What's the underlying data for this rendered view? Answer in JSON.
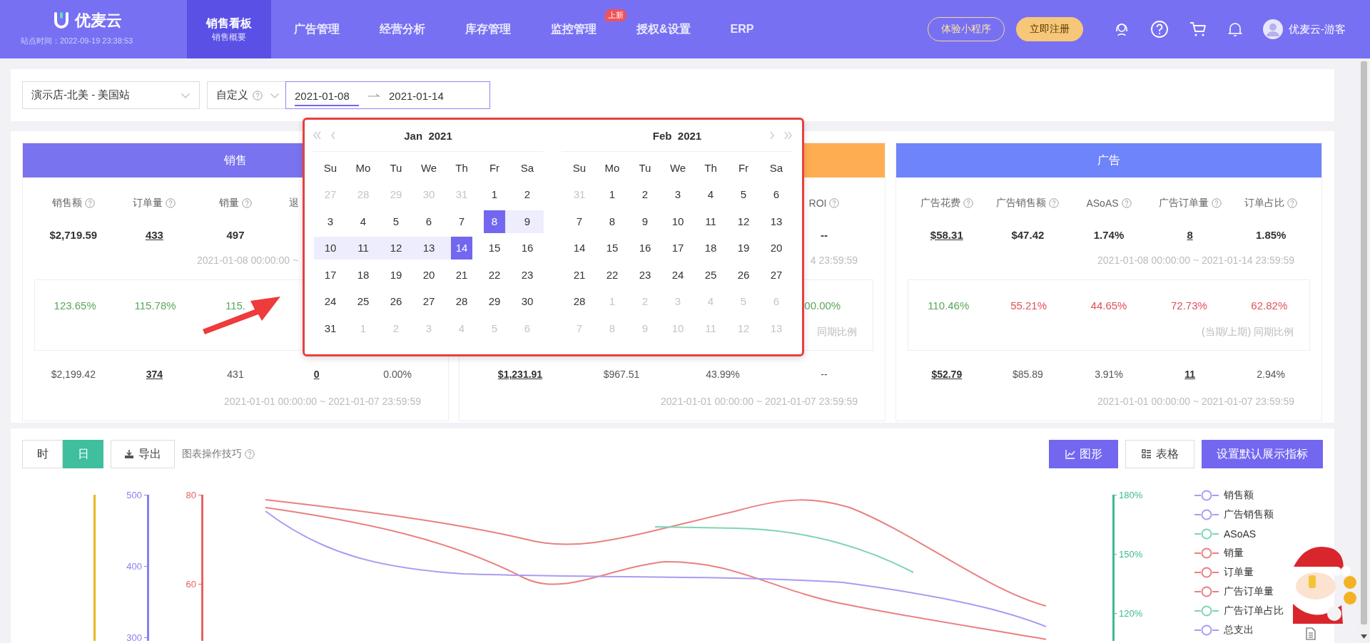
{
  "header": {
    "logo": "优麦云",
    "site_time": "站点时间：2022-09-19 23:38:53",
    "nav": [
      {
        "label": "销售看板",
        "sub": "销售概要",
        "selected": true
      },
      {
        "label": "广告管理",
        "selected": false
      },
      {
        "label": "经营分析",
        "selected": false
      },
      {
        "label": "库存管理",
        "selected": false
      },
      {
        "label": "监控管理",
        "badge": "上新",
        "selected": false
      },
      {
        "label": "授权&设置",
        "selected": false
      },
      {
        "label": "ERP",
        "selected": false
      }
    ],
    "actions": [
      {
        "label": "体验小程序",
        "kind": "outline"
      },
      {
        "label": "立即注册",
        "kind": "gold"
      }
    ],
    "user": "优麦云-游客"
  },
  "filters": {
    "store": "演示店-北美 - 美国站",
    "period": "自定义",
    "date_start": "2021-01-08",
    "date_end": "2021-01-14"
  },
  "date_picker": {
    "months": [
      {
        "title": "Jan  2021",
        "weekdays": [
          "Su",
          "Mo",
          "Tu",
          "We",
          "Th",
          "Fr",
          "Sa"
        ],
        "days": [
          {
            "day": "27",
            "outside": true,
            "selected": false,
            "in_range": false
          },
          {
            "day": "28",
            "outside": true,
            "selected": false,
            "in_range": false
          },
          {
            "day": "29",
            "outside": true,
            "selected": false,
            "in_range": false
          },
          {
            "day": "30",
            "outside": true,
            "selected": false,
            "in_range": false
          },
          {
            "day": "31",
            "outside": true,
            "selected": false,
            "in_range": false
          },
          {
            "day": "1",
            "outside": false,
            "selected": false,
            "in_range": false
          },
          {
            "day": "2",
            "outside": false,
            "selected": false,
            "in_range": false
          },
          {
            "day": "3",
            "outside": false,
            "selected": false,
            "in_range": false
          },
          {
            "day": "4",
            "outside": false,
            "selected": false,
            "in_range": false
          },
          {
            "day": "5",
            "outside": false,
            "selected": false,
            "in_range": false
          },
          {
            "day": "6",
            "outside": false,
            "selected": false,
            "in_range": false
          },
          {
            "day": "7",
            "outside": false,
            "selected": false,
            "in_range": false
          },
          {
            "day": "8",
            "outside": false,
            "selected": true,
            "in_range": false
          },
          {
            "day": "9",
            "outside": false,
            "selected": false,
            "in_range": true
          },
          {
            "day": "10",
            "outside": false,
            "selected": false,
            "in_range": true
          },
          {
            "day": "11",
            "outside": false,
            "selected": false,
            "in_range": true
          },
          {
            "day": "12",
            "outside": false,
            "selected": false,
            "in_range": true
          },
          {
            "day": "13",
            "outside": false,
            "selected": false,
            "in_range": true
          },
          {
            "day": "14",
            "outside": false,
            "selected": true,
            "in_range": false
          },
          {
            "day": "15",
            "outside": false,
            "selected": false,
            "in_range": false
          },
          {
            "day": "16",
            "outside": false,
            "selected": false,
            "in_range": false
          },
          {
            "day": "17",
            "outside": false,
            "selected": false,
            "in_range": false
          },
          {
            "day": "18",
            "outside": false,
            "selected": false,
            "in_range": false
          },
          {
            "day": "19",
            "outside": false,
            "selected": false,
            "in_range": false
          },
          {
            "day": "20",
            "outside": false,
            "selected": false,
            "in_range": false
          },
          {
            "day": "21",
            "outside": false,
            "selected": false,
            "in_range": false
          },
          {
            "day": "22",
            "outside": false,
            "selected": false,
            "in_range": false
          },
          {
            "day": "23",
            "outside": false,
            "selected": false,
            "in_range": false
          },
          {
            "day": "24",
            "outside": false,
            "selected": false,
            "in_range": false
          },
          {
            "day": "25",
            "outside": false,
            "selected": false,
            "in_range": false
          },
          {
            "day": "26",
            "outside": false,
            "selected": false,
            "in_range": false
          },
          {
            "day": "27",
            "outside": false,
            "selected": false,
            "in_range": false
          },
          {
            "day": "28",
            "outside": false,
            "selected": false,
            "in_range": false
          },
          {
            "day": "29",
            "outside": false,
            "selected": false,
            "in_range": false
          },
          {
            "day": "30",
            "outside": false,
            "selected": false,
            "in_range": false
          },
          {
            "day": "31",
            "outside": false,
            "selected": false,
            "in_range": false
          },
          {
            "day": "1",
            "outside": true,
            "selected": false,
            "in_range": false
          },
          {
            "day": "2",
            "outside": true,
            "selected": false,
            "in_range": false
          },
          {
            "day": "3",
            "outside": true,
            "selected": false,
            "in_range": false
          },
          {
            "day": "4",
            "outside": true,
            "selected": false,
            "in_range": false
          },
          {
            "day": "5",
            "outside": true,
            "selected": false,
            "in_range": false
          },
          {
            "day": "6",
            "outside": true,
            "selected": false,
            "in_range": false
          }
        ]
      },
      {
        "title": "Feb  2021",
        "weekdays": [
          "Su",
          "Mo",
          "Tu",
          "We",
          "Th",
          "Fr",
          "Sa"
        ],
        "days": [
          {
            "day": "31",
            "outside": true,
            "selected": false,
            "in_range": false
          },
          {
            "day": "1",
            "outside": false,
            "selected": false,
            "in_range": false
          },
          {
            "day": "2",
            "outside": false,
            "selected": false,
            "in_range": false
          },
          {
            "day": "3",
            "outside": false,
            "selected": false,
            "in_range": false
          },
          {
            "day": "4",
            "outside": false,
            "selected": false,
            "in_range": false
          },
          {
            "day": "5",
            "outside": false,
            "selected": false,
            "in_range": false
          },
          {
            "day": "6",
            "outside": false,
            "selected": false,
            "in_range": false
          },
          {
            "day": "7",
            "outside": false,
            "selected": false,
            "in_range": false
          },
          {
            "day": "8",
            "outside": false,
            "selected": false,
            "in_range": false
          },
          {
            "day": "9",
            "outside": false,
            "selected": false,
            "in_range": false
          },
          {
            "day": "10",
            "outside": false,
            "selected": false,
            "in_range": false
          },
          {
            "day": "11",
            "outside": false,
            "selected": false,
            "in_range": false
          },
          {
            "day": "12",
            "outside": false,
            "selected": false,
            "in_range": false
          },
          {
            "day": "13",
            "outside": false,
            "selected": false,
            "in_range": false
          },
          {
            "day": "14",
            "outside": false,
            "selected": false,
            "in_range": false
          },
          {
            "day": "15",
            "outside": false,
            "selected": false,
            "in_range": false
          },
          {
            "day": "16",
            "outside": false,
            "selected": false,
            "in_range": false
          },
          {
            "day": "17",
            "outside": false,
            "selected": false,
            "in_range": false
          },
          {
            "day": "18",
            "outside": false,
            "selected": false,
            "in_range": false
          },
          {
            "day": "19",
            "outside": false,
            "selected": false,
            "in_range": false
          },
          {
            "day": "20",
            "outside": false,
            "selected": false,
            "in_range": false
          },
          {
            "day": "21",
            "outside": false,
            "selected": false,
            "in_range": false
          },
          {
            "day": "22",
            "outside": false,
            "selected": false,
            "in_range": false
          },
          {
            "day": "23",
            "outside": false,
            "selected": false,
            "in_range": false
          },
          {
            "day": "24",
            "outside": false,
            "selected": false,
            "in_range": false
          },
          {
            "day": "25",
            "outside": false,
            "selected": false,
            "in_range": false
          },
          {
            "day": "26",
            "outside": false,
            "selected": false,
            "in_range": false
          },
          {
            "day": "27",
            "outside": false,
            "selected": false,
            "in_range": false
          },
          {
            "day": "28",
            "outside": false,
            "selected": false,
            "in_range": false
          },
          {
            "day": "1",
            "outside": true,
            "selected": false,
            "in_range": false
          },
          {
            "day": "2",
            "outside": true,
            "selected": false,
            "in_range": false
          },
          {
            "day": "3",
            "outside": true,
            "selected": false,
            "in_range": false
          },
          {
            "day": "4",
            "outside": true,
            "selected": false,
            "in_range": false
          },
          {
            "day": "5",
            "outside": true,
            "selected": false,
            "in_range": false
          },
          {
            "day": "6",
            "outside": true,
            "selected": false,
            "in_range": false
          },
          {
            "day": "7",
            "outside": true,
            "selected": false,
            "in_range": false
          },
          {
            "day": "8",
            "outside": true,
            "selected": false,
            "in_range": false
          },
          {
            "day": "9",
            "outside": true,
            "selected": false,
            "in_range": false
          },
          {
            "day": "10",
            "outside": true,
            "selected": false,
            "in_range": false
          },
          {
            "day": "11",
            "outside": true,
            "selected": false,
            "in_range": false
          },
          {
            "day": "12",
            "outside": true,
            "selected": false,
            "in_range": false
          },
          {
            "day": "13",
            "outside": true,
            "selected": false,
            "in_range": false
          }
        ]
      }
    ]
  },
  "cards": [
    {
      "title": "销售",
      "color": "#7a73f0",
      "current_range": "2021-01-08 00:00:00 ~",
      "current_range_cut": true,
      "previous_range": "2021-01-01 00:00:00 ~ 2021-01-07 23:59:59",
      "metrics": [
        {
          "label": "销售额",
          "help": true,
          "current": "$2,719.59",
          "current_link": false,
          "ratio": {
            "text": "123.65%",
            "color": "#5aa75a"
          },
          "previous": "$2,199.42",
          "previous_link": false
        },
        {
          "label": "订单量",
          "help": true,
          "current": "433",
          "current_link": true,
          "ratio": {
            "text": "115.78%",
            "color": "#5aa75a"
          },
          "previous": "374",
          "previous_link": true
        },
        {
          "label": "销量",
          "help": true,
          "current": "497",
          "current_link": false,
          "ratio": {
            "text": "115.",
            "color": "#5aa75a"
          },
          "previous": "431",
          "previous_link": false
        },
        {
          "label": "退",
          "label_cut": true,
          "previous": "0",
          "previous_link": true
        },
        {
          "previous": "0.00%",
          "previous_link": false
        }
      ]
    },
    {
      "color": "#ffad52",
      "current_range": "4 23:59:59",
      "current_range_cut": false,
      "ratio_note": "同期比例",
      "previous_range": "2021-01-01 00:00:00 ~ 2021-01-07 23:59:59",
      "metrics": [
        {
          "previous": "$1,231.91",
          "previous_link": true
        },
        {
          "previous": "$967.51",
          "previous_link": false
        },
        {
          "previous": "43.99%",
          "previous_link": false
        },
        {
          "label": "ROI",
          "help": true,
          "current": "--",
          "current_link": false,
          "ratio": {
            "text": "00.00%",
            "color": "#5aa75a"
          },
          "previous": "--",
          "previous_link": false
        }
      ]
    },
    {
      "title": "广告",
      "color": "#6e84fb",
      "current_range": "2021-01-08 00:00:00 ~ 2021-01-14 23:59:59",
      "current_range_cut": false,
      "ratio_note": "(当期/上期) 同期比例",
      "previous_range": "2021-01-01 00:00:00 ~ 2021-01-07 23:59:59",
      "metrics": [
        {
          "label": "广告花费",
          "help": true,
          "current": "$58.31",
          "current_link": true,
          "ratio": {
            "text": "110.46%",
            "color": "#5aa75a"
          },
          "previous": "$52.79",
          "previous_link": true
        },
        {
          "label": "广告销售额",
          "help": true,
          "current": "$47.42",
          "current_link": false,
          "ratio": {
            "text": "55.21%",
            "color": "#e0505a"
          },
          "previous": "$85.89",
          "previous_link": false
        },
        {
          "label": "ASoAS",
          "help": true,
          "current": "1.74%",
          "current_link": false,
          "ratio": {
            "text": "44.65%",
            "color": "#e0505a"
          },
          "previous": "3.91%",
          "previous_link": false
        },
        {
          "label": "广告订单量",
          "help": true,
          "current": "8",
          "current_link": true,
          "ratio": {
            "text": "72.73%",
            "color": "#e0505a"
          },
          "previous": "11",
          "previous_link": true
        },
        {
          "label": "订单占比",
          "help": true,
          "current": "1.85%",
          "current_link": false,
          "ratio": {
            "text": "62.82%",
            "color": "#e0505a"
          },
          "previous": "2.94%",
          "previous_link": false
        }
      ]
    }
  ],
  "toolbar": {
    "granularity": [
      {
        "label": "时",
        "selected": false
      },
      {
        "label": "日",
        "selected": true
      }
    ],
    "export": "导出",
    "tips": "图表操作技巧",
    "views": [
      {
        "label": "图形",
        "kind": "chart",
        "selected": true
      },
      {
        "label": "表格",
        "kind": "table",
        "selected": false
      }
    ],
    "settings": "设置默认展示指标"
  },
  "chart": {
    "axes": [
      {
        "color": "#e8b820"
      },
      {
        "color": "#8a80f0",
        "ticks": [
          "500",
          "400",
          "300"
        ]
      },
      {
        "color": "#e46464",
        "ticks": [
          "80",
          "60"
        ]
      },
      {
        "color": "#3dbb8f",
        "ticks": [
          "180%",
          "150%",
          "120%"
        ]
      }
    ],
    "legend": [
      {
        "label": "销售额",
        "color": "#a99cf2"
      },
      {
        "label": "广告销售额",
        "color": "#a99cf2"
      },
      {
        "label": "ASoAS",
        "color": "#7fd4b4"
      },
      {
        "label": "销量",
        "color": "#ea8080"
      },
      {
        "label": "订单量",
        "color": "#ea8080"
      },
      {
        "label": "广告订单量",
        "color": "#ea8080"
      },
      {
        "label": "广告订单占比",
        "color": "#7fd4b4"
      },
      {
        "label": "总支出",
        "color": "#a99cf2"
      }
    ]
  }
}
